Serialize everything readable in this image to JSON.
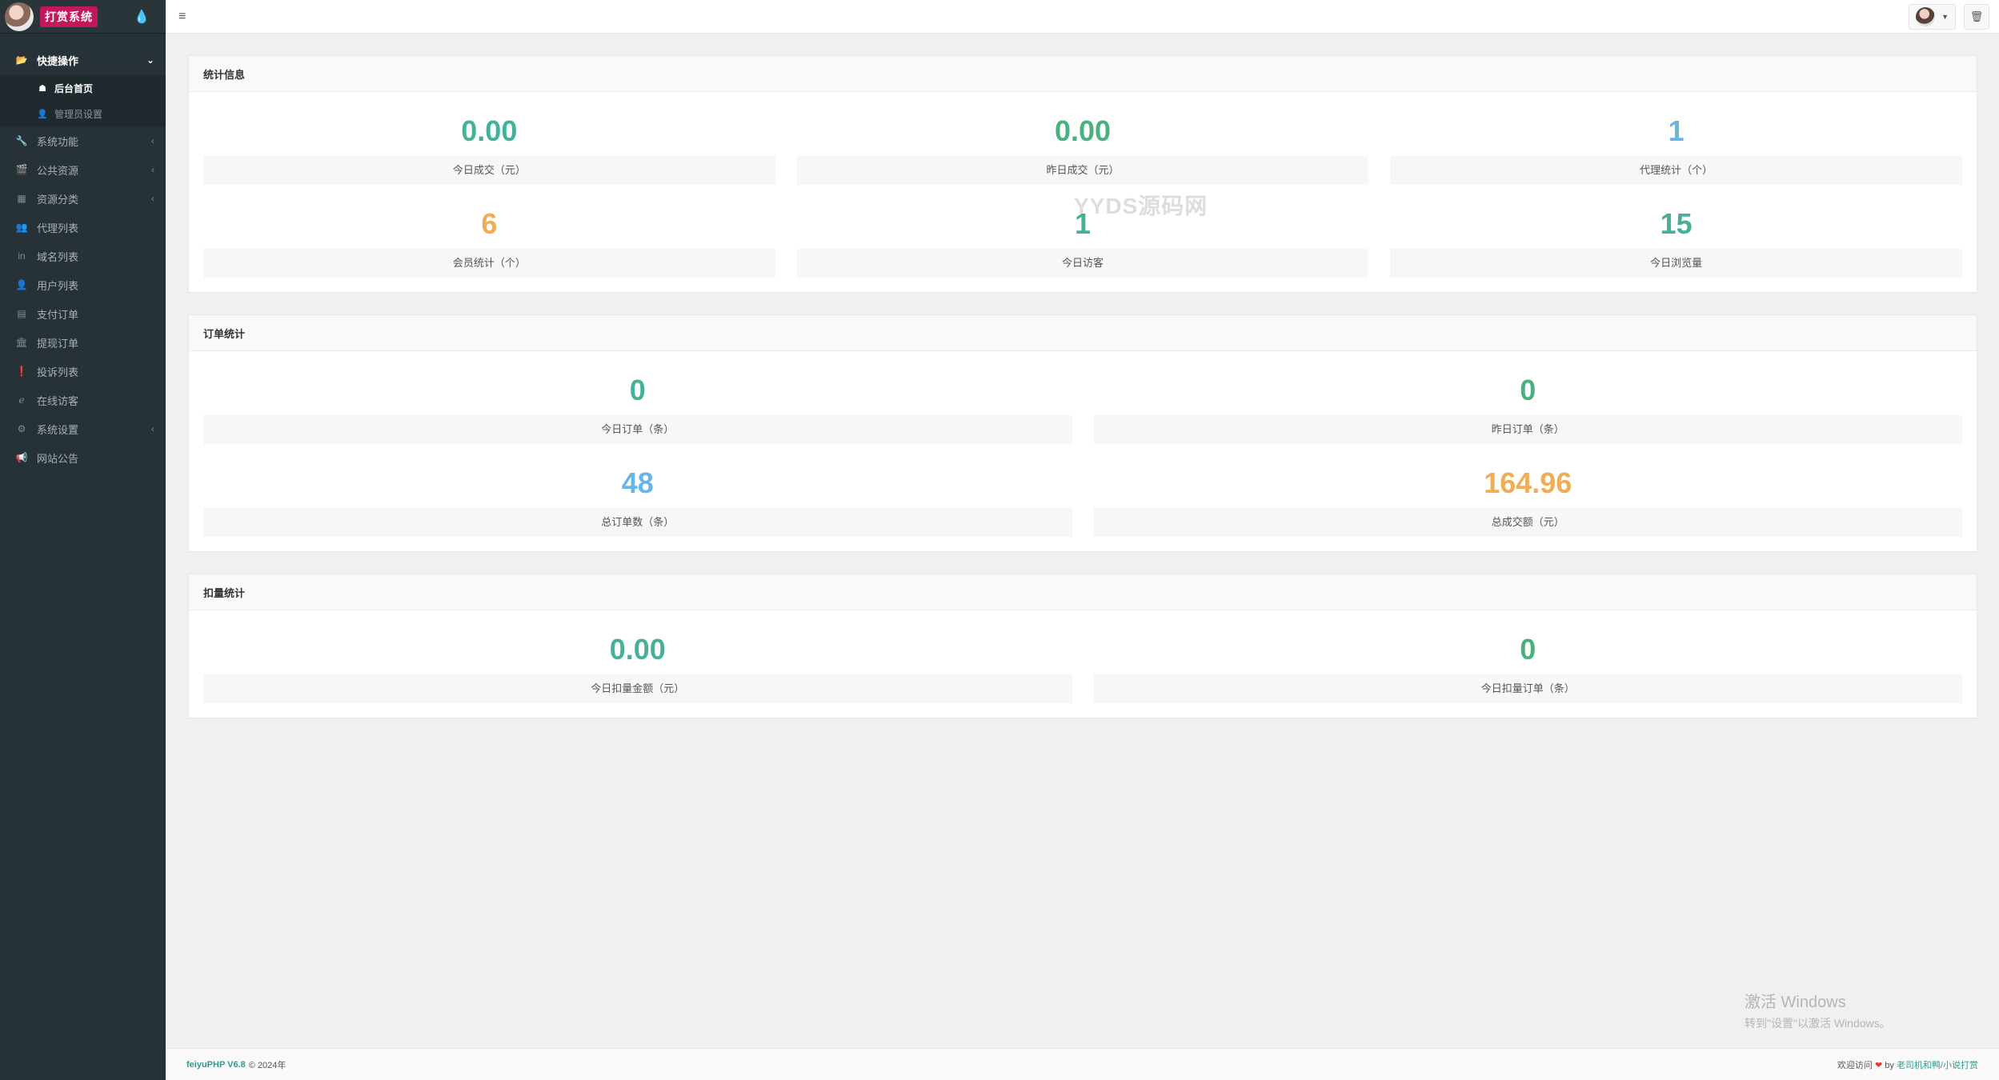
{
  "brand": {
    "logo_text": "打赏系统",
    "drop_icon": "💧"
  },
  "topbar": {
    "hamburger_icon": "≡",
    "caret": "▼",
    "trash_icon": "🗑"
  },
  "sidebar": {
    "open_group": {
      "label": "快捷操作",
      "icon": "📂",
      "arrow": "⌄"
    },
    "sub_items": [
      {
        "label": "后台首页",
        "icon": "☗",
        "active": true
      },
      {
        "label": "管理员设置",
        "icon": "👤",
        "active": false
      }
    ],
    "items": [
      {
        "label": "系统功能",
        "icon": "🔧",
        "arrow": "‹"
      },
      {
        "label": "公共资源",
        "icon": "🎬",
        "arrow": "‹"
      },
      {
        "label": "资源分类",
        "icon": "▦",
        "arrow": "‹"
      },
      {
        "label": "代理列表",
        "icon": "👥",
        "arrow": ""
      },
      {
        "label": "域名列表",
        "icon": "in",
        "arrow": ""
      },
      {
        "label": "用户列表",
        "icon": "👤",
        "arrow": ""
      },
      {
        "label": "支付订单",
        "icon": "▤",
        "arrow": ""
      },
      {
        "label": "提现订单",
        "icon": "🏛",
        "arrow": ""
      },
      {
        "label": "投诉列表",
        "icon": "❗",
        "arrow": ""
      },
      {
        "label": "在线访客",
        "icon": "ℯ",
        "arrow": ""
      },
      {
        "label": "系统设置",
        "icon": "⚙",
        "arrow": "‹"
      },
      {
        "label": "网站公告",
        "icon": "📢",
        "arrow": ""
      }
    ]
  },
  "panels": {
    "stats": {
      "title": "统计信息",
      "items": [
        {
          "value": "0.00",
          "label": "今日成交（元）"
        },
        {
          "value": "0.00",
          "label": "昨日成交（元）"
        },
        {
          "value": "1",
          "label": "代理统计（个）"
        },
        {
          "value": "6",
          "label": "会员统计（个）"
        },
        {
          "value": "1",
          "label": "今日访客"
        },
        {
          "value": "15",
          "label": "今日浏览量"
        }
      ]
    },
    "orders": {
      "title": "订单统计",
      "items": [
        {
          "value": "0",
          "label": "今日订单（条）"
        },
        {
          "value": "0",
          "label": "昨日订单（条）"
        },
        {
          "value": "48",
          "label": "总订单数（条）"
        },
        {
          "value": "164.96",
          "label": "总成交额（元）"
        }
      ]
    },
    "deduct": {
      "title": "扣量统计",
      "items": [
        {
          "value": "0.00",
          "label": "今日扣量金额（元）"
        },
        {
          "value": "0",
          "label": "今日扣量订单（条）"
        }
      ]
    }
  },
  "watermark": "YYDS源码网",
  "windows_activation": {
    "line1": "激活 Windows",
    "line2": "转到\"设置\"以激活 Windows。"
  },
  "footer": {
    "brand": "feiyuPHP V6.8",
    "copyright": "© 2024年",
    "welcome": "欢迎访问",
    "heart": "❤",
    "by": "by",
    "author": "老司机和鸭/小说打赏"
  },
  "colors": {
    "sidebar_bg": "#263238",
    "teal": "#46b19a",
    "green": "#4ab17e",
    "blue": "#69b5e6",
    "orange": "#f0ad55"
  }
}
